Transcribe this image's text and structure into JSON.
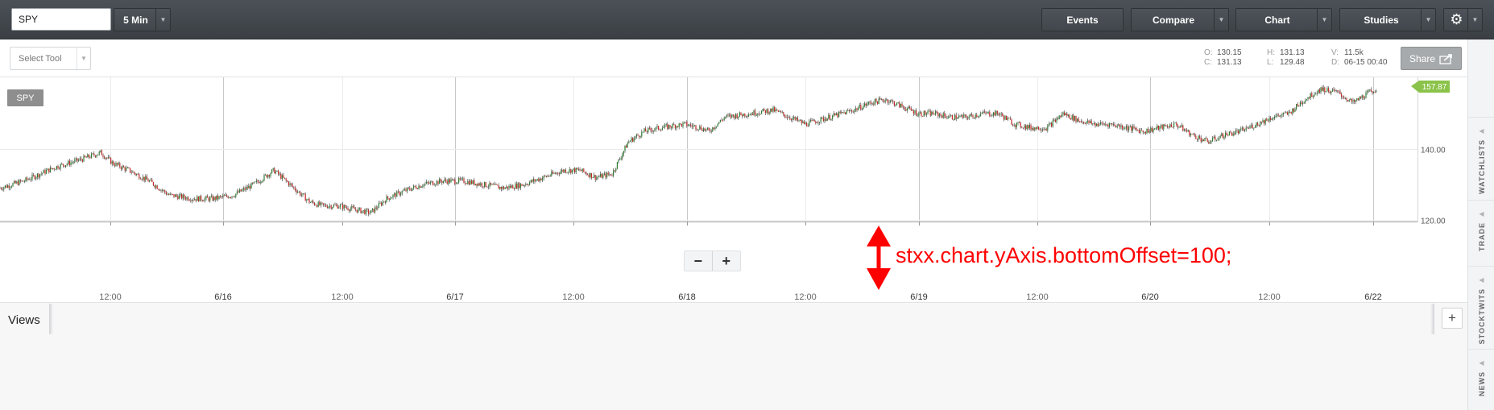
{
  "toolbar": {
    "symbol_value": "SPY",
    "periodicity": "5 Min",
    "events": "Events",
    "compare": "Compare",
    "chart": "Chart",
    "studies": "Studies"
  },
  "subtoolbar": {
    "select_tool": "Select Tool",
    "share": "Share"
  },
  "hud": {
    "o_label": "O:",
    "o": "130.15",
    "c_label": "C:",
    "c": "131.13",
    "h_label": "H:",
    "h": "131.13",
    "l_label": "L:",
    "l": "129.48",
    "v_label": "V:",
    "v": "11.5k",
    "d_label": "D:",
    "d": "06-15 00:40"
  },
  "chart": {
    "symbol": "SPY",
    "current_price": "157.87",
    "y_ticks": [
      "140.00",
      "120.00"
    ],
    "x_labels": [
      "12:00",
      "6/16",
      "12:00",
      "6/17",
      "12:00",
      "6/18",
      "12:00",
      "6/19",
      "12:00",
      "6/20",
      "12:00",
      "6/22"
    ],
    "annotation": "stxx.chart.yAxis.bottomOffset=100;",
    "colors": {
      "up": "#2e7d32",
      "down": "#c62828",
      "price_flag": "#8bc34a",
      "annotation": "#ff0000"
    }
  },
  "zoom": {
    "minus": "−",
    "plus": "+"
  },
  "views": {
    "label": "Views",
    "add": "+"
  },
  "sidepanel": {
    "tabs": [
      "WATCHLISTS",
      "TRADE",
      "STOCKTWITS",
      "NEWS"
    ]
  },
  "chart_data": {
    "type": "candlestick",
    "interval": "5 Min",
    "x_labels": [
      "12:00",
      "6/16",
      "12:00",
      "6/17",
      "12:00",
      "6/18",
      "12:00",
      "6/19",
      "12:00",
      "6/20",
      "12:00",
      "6/22"
    ],
    "ylim": [
      117,
      160
    ],
    "y_ticks": [
      120,
      140
    ],
    "last_price": 157.87,
    "close_path": [
      [
        0,
        129
      ],
      [
        30,
        131
      ],
      [
        70,
        135
      ],
      [
        100,
        137
      ],
      [
        125,
        139
      ],
      [
        140,
        136
      ],
      [
        160,
        134
      ],
      [
        185,
        131
      ],
      [
        210,
        127
      ],
      [
        240,
        126
      ],
      [
        265,
        126
      ],
      [
        290,
        127
      ],
      [
        315,
        130
      ],
      [
        340,
        134
      ],
      [
        365,
        129
      ],
      [
        385,
        125
      ],
      [
        400,
        124
      ],
      [
        420,
        124
      ],
      [
        440,
        123
      ],
      [
        460,
        122
      ],
      [
        480,
        126
      ],
      [
        500,
        128
      ],
      [
        525,
        130
      ],
      [
        550,
        131
      ],
      [
        575,
        131
      ],
      [
        600,
        130
      ],
      [
        625,
        129
      ],
      [
        650,
        130
      ],
      [
        675,
        132
      ],
      [
        700,
        134
      ],
      [
        720,
        134
      ],
      [
        740,
        132
      ],
      [
        760,
        133
      ],
      [
        780,
        142
      ],
      [
        800,
        145
      ],
      [
        820,
        146
      ],
      [
        850,
        147
      ],
      [
        870,
        146
      ],
      [
        880,
        145
      ],
      [
        900,
        149
      ],
      [
        930,
        150
      ],
      [
        960,
        151
      ],
      [
        980,
        149
      ],
      [
        1000,
        147
      ],
      [
        1030,
        149
      ],
      [
        1060,
        151
      ],
      [
        1080,
        153
      ],
      [
        1100,
        154
      ],
      [
        1120,
        152
      ],
      [
        1140,
        150
      ],
      [
        1160,
        150
      ],
      [
        1180,
        149
      ],
      [
        1200,
        149
      ],
      [
        1220,
        150
      ],
      [
        1240,
        150
      ],
      [
        1260,
        147
      ],
      [
        1280,
        146
      ],
      [
        1300,
        146
      ],
      [
        1320,
        150
      ],
      [
        1340,
        148
      ],
      [
        1360,
        147
      ],
      [
        1380,
        147
      ],
      [
        1400,
        146
      ],
      [
        1420,
        145
      ],
      [
        1440,
        146
      ],
      [
        1460,
        147
      ],
      [
        1480,
        144
      ],
      [
        1500,
        142
      ],
      [
        1520,
        144
      ],
      [
        1540,
        145
      ],
      [
        1560,
        147
      ],
      [
        1580,
        149
      ],
      [
        1600,
        150
      ],
      [
        1620,
        154
      ],
      [
        1640,
        157
      ],
      [
        1660,
        156
      ],
      [
        1680,
        153
      ],
      [
        1700,
        156
      ],
      [
        1710,
        157
      ]
    ]
  }
}
